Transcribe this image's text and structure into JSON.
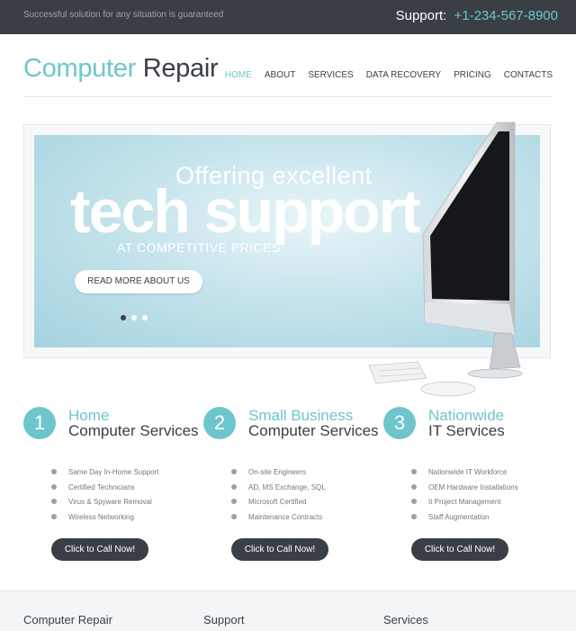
{
  "topbar": {
    "tagline": "Successful solution for any situation is guaranteed",
    "support_label": "Support:",
    "support_phone": "+1-234-567-8900"
  },
  "logo": {
    "part1": "Computer",
    "part2": "Repair"
  },
  "nav": {
    "items": [
      {
        "label": "HOME"
      },
      {
        "label": "ABOUT"
      },
      {
        "label": "SERVICES"
      },
      {
        "label": "DATA RECOVERY"
      },
      {
        "label": "PRICING"
      },
      {
        "label": "CONTACTS"
      }
    ]
  },
  "slider": {
    "line1": "Offering excellent",
    "line2": "tech support",
    "line3": "AT COMPETITIVE PRICES",
    "button": "READ MORE ABOUT US"
  },
  "columns": [
    {
      "number": "1",
      "title1": "Home",
      "title2": "Computer Services",
      "items": [
        "Same Day In-Home Support",
        "Certified Technicians",
        "Virus & Spyware Removal",
        "Wireless Networking"
      ],
      "button": "Click to Call Now!"
    },
    {
      "number": "2",
      "title1": "Small Business",
      "title2": "Computer Services",
      "items": [
        "On-site Engineers",
        "AD, MS Exchange, SQL",
        "Microsoft Certified",
        "Maintenance Contracts"
      ],
      "button": "Click to Call Now!"
    },
    {
      "number": "3",
      "title1": "Nationwide",
      "title2": "IT Services",
      "items": [
        "Nationwide IT Workforce",
        "OEM Hardware Installations",
        "It Project Management",
        "Staff Augmentation"
      ],
      "button": "Click to Call Now!"
    }
  ],
  "footer": {
    "headings": [
      "Computer Repair",
      "Support",
      "Services"
    ]
  }
}
